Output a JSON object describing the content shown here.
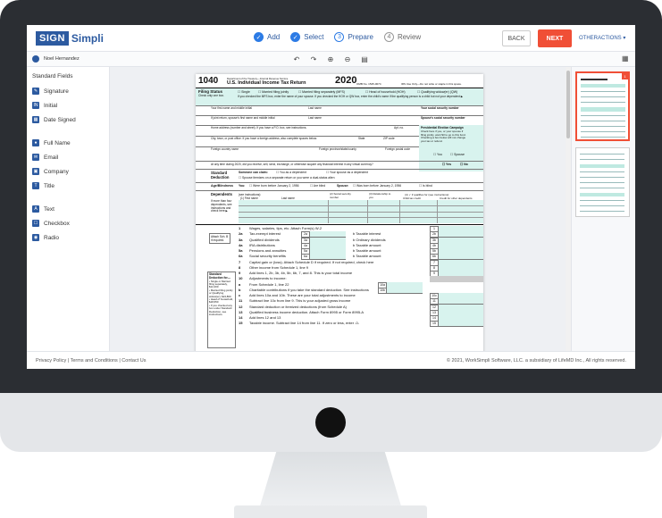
{
  "app": {
    "logo_sign": "SIGN",
    "logo_simpli": "Simpli",
    "steps": [
      {
        "label": "Add",
        "state": "done"
      },
      {
        "label": "Select",
        "state": "done"
      },
      {
        "label": "Prepare",
        "num": "3",
        "state": "current"
      },
      {
        "label": "Review",
        "num": "4",
        "state": "todo"
      }
    ],
    "back_label": "BACK",
    "next_label": "NEXT",
    "other_actions_label": "OTHERACTIONS ▾",
    "accent": "#2c5aa0",
    "next_color": "#f04f36"
  },
  "subbar": {
    "user_name": "Noel Hernandez"
  },
  "sidebar": {
    "title": "Standard Fields",
    "items": [
      {
        "label": "Signature",
        "icon": "signature-icon"
      },
      {
        "label": "Initial",
        "icon": "initial-icon"
      },
      {
        "label": "Date Signed",
        "icon": "calendar-icon"
      },
      {
        "label": "Full Name",
        "icon": "person-icon"
      },
      {
        "label": "Email",
        "icon": "email-icon"
      },
      {
        "label": "Company",
        "icon": "company-icon"
      },
      {
        "label": "Title",
        "icon": "title-icon"
      },
      {
        "label": "Text",
        "icon": "text-icon"
      },
      {
        "label": "Checkbox",
        "icon": "checkbox-icon"
      },
      {
        "label": "Radio",
        "icon": "radio-icon"
      }
    ]
  },
  "document": {
    "form_number": "1040",
    "dept": "Department of the Treasury—Internal Revenue Service",
    "year": "2020",
    "title": "U.S. Individual Income Tax Return",
    "omb": "OMB No. 1545-0074",
    "irs_use": "IRS Use Only—Do not write or staple in this space.",
    "filing_status_label": "Filing Status",
    "filing_status_sub": "Check only one box.",
    "filing_options": [
      "Single",
      "Married filing jointly",
      "Married filing separately (MFS)",
      "Head of household (HOH)",
      "Qualifying widow(er) (QW)"
    ],
    "mfs_note": "If you checked the MFS box, enter the name of your spouse. If you checked the HOH or QW box, enter the child's name if the qualifying person is a child but not your dependent ▶",
    "name_label": "Your first name and middle initial",
    "last_name_label": "Last name",
    "ssn_label": "Your social security number",
    "spouse_name_label": "If joint return, spouse's first name and middle initial",
    "spouse_ssn_label": "Spouse's social security number",
    "address_label": "Home address (number and street). If you have a P.O. box, see instructions.",
    "apt_label": "Apt. no.",
    "pec_label": "Presidential Election Campaign",
    "pec_text": "Check here if you, or your spouse if filing jointly, want $3 to go to this fund. Checking a box below will not change your tax or refund.",
    "city_label": "City, town, or post office. If you have a foreign address, also complete spaces below.",
    "state_label": "State",
    "zip_label": "ZIP code",
    "country_label": "Foreign country name",
    "province_label": "Foreign province/state/county",
    "postal_label": "Foreign postal code",
    "you_label": "You",
    "spouse_label": "Spouse",
    "virtual_q": "At any time during 2020, did you receive, sell, send, exchange, or otherwise acquire any financial interest in any virtual currency?",
    "yes": "Yes",
    "no": "No",
    "std_ded_label": "Standard Deduction",
    "someone_claim": "Someone can claim:",
    "you_dependent": "You as a dependent",
    "spouse_dependent": "Your spouse as a dependent",
    "spouse_itemizes": "Spouse itemizes on a separate return or you were a dual-status alien",
    "age_label": "Age/Blindness",
    "you_colon": "You:",
    "born_before": "Were born before January 2, 1956",
    "are_blind": "Are blind",
    "spouse_colon": "Spouse:",
    "spouse_born": "Was born before January 2, 1956",
    "is_blind": "Is blind",
    "dependents_label": "Dependents",
    "see_instr": "(see instructions):",
    "dep_cols": [
      "(1) First name",
      "Last name",
      "(2) Social security number",
      "(3) Relationship to you",
      "(4) ✓ if qualifies for (see instructions):"
    ],
    "dep_sub": [
      "Child tax credit",
      "Credit for other dependents"
    ],
    "more_four": "If more than four dependents, see instructions and check here ▶",
    "attach": "Attach Sch. B if required.",
    "std_box_title": "Standard Deduction for—",
    "std_box_lines": [
      "• Single or Married filing separately, $12,400",
      "• Married filing jointly or Qualifying widow(er), $24,800",
      "• Head of household, $18,650",
      "• If you checked any box under Standard Deduction, see instructions."
    ],
    "lines": [
      {
        "num": "1",
        "label": "Wages, salaries, tips, etc. Attach Form(s) W-2",
        "box": "1"
      },
      {
        "num": "2a",
        "label": "Tax-exempt interest",
        "sub": "2a",
        "mid": "b Taxable interest",
        "box": "2b"
      },
      {
        "num": "3a",
        "label": "Qualified dividends",
        "sub": "3a",
        "mid": "b Ordinary dividends",
        "box": "3b"
      },
      {
        "num": "4a",
        "label": "IRA distributions",
        "sub": "4a",
        "mid": "b Taxable amount",
        "box": "4b"
      },
      {
        "num": "5a",
        "label": "Pensions and annuities",
        "sub": "5a",
        "mid": "b Taxable amount",
        "box": "5b"
      },
      {
        "num": "6a",
        "label": "Social security benefits",
        "sub": "6a",
        "mid": "b Taxable amount",
        "box": "6b"
      },
      {
        "num": "7",
        "label": "Capital gain or (loss). Attach Schedule D if required. If not required, check here",
        "box": "7"
      },
      {
        "num": "8",
        "label": "Other income from Schedule 1, line 9",
        "box": "8"
      },
      {
        "num": "9",
        "label": "Add lines 1, 2b, 3b, 4b, 5b, 6b, 7, and 8. This is your total income",
        "box": "9"
      },
      {
        "num": "10",
        "label": "Adjustments to income:"
      },
      {
        "num": "a",
        "label": "From Schedule 1, line 22",
        "sub": "10a"
      },
      {
        "num": "b",
        "label": "Charitable contributions if you take the standard deduction. See instructions",
        "sub": "10b"
      },
      {
        "num": "c",
        "label": "Add lines 10a and 10b. These are your total adjustments to income",
        "box": "10c"
      },
      {
        "num": "11",
        "label": "Subtract line 10c from line 9. This is your adjusted gross income",
        "box": "11"
      },
      {
        "num": "12",
        "label": "Standard deduction or itemized deductions (from Schedule A)",
        "box": "12"
      },
      {
        "num": "13",
        "label": "Qualified business income deduction. Attach Form 8995 or Form 8995-A",
        "box": "13"
      },
      {
        "num": "14",
        "label": "Add lines 12 and 13",
        "box": "14"
      },
      {
        "num": "15",
        "label": "Taxable income. Subtract line 14 from line 11. If zero or less, enter -0-",
        "box": "15"
      }
    ]
  },
  "thumbnails": {
    "selected_badge": "1"
  },
  "footer": {
    "left": "Privacy Policy | Terms and Conditions | Contact Us",
    "right": "© 2021, WorkSimpli Software, LLC. a subsidiary of LifeMD Inc., All rights reserved."
  }
}
